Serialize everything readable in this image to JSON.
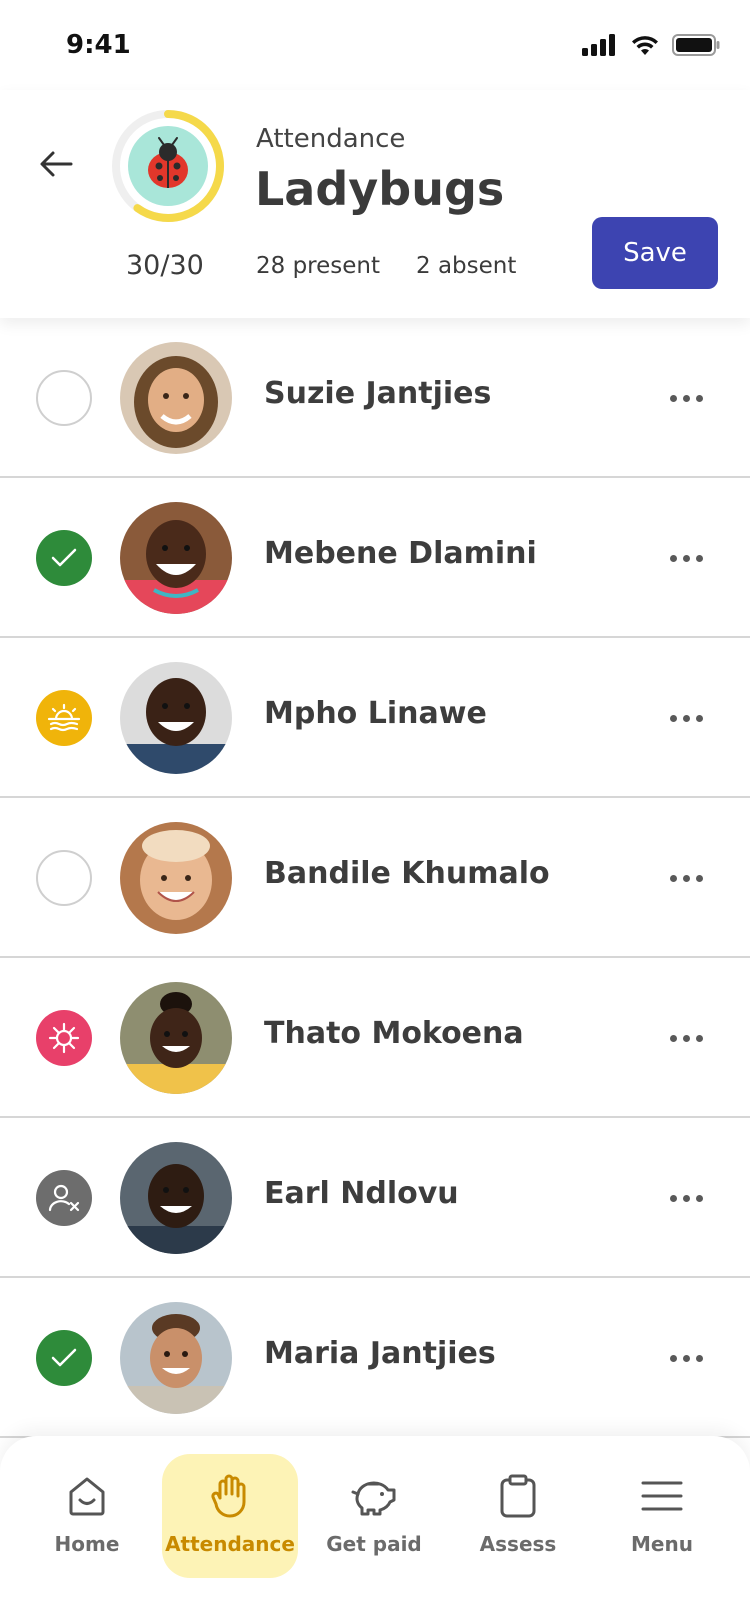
{
  "status_bar": {
    "time": "9:41"
  },
  "header": {
    "subtitle": "Attendance",
    "title": "Ladybugs",
    "count_total": "30/30",
    "count_present": "28 present",
    "count_absent": "2 absent",
    "save_label": "Save",
    "progress": 0.6
  },
  "children": [
    {
      "name": "Suzie Jantjies",
      "status": "unmarked"
    },
    {
      "name": "Mebene Dlamini",
      "status": "present"
    },
    {
      "name": "Mpho Linawe",
      "status": "late"
    },
    {
      "name": "Bandile Khumalo",
      "status": "unmarked"
    },
    {
      "name": "Thato Mokoena",
      "status": "sick"
    },
    {
      "name": "Earl Ndlovu",
      "status": "absent"
    },
    {
      "name": "Maria Jantjies",
      "status": "present"
    }
  ],
  "nav": {
    "items": [
      {
        "label": "Home",
        "icon": "home-icon"
      },
      {
        "label": "Attendance",
        "icon": "hand-icon",
        "active": true
      },
      {
        "label": "Get paid",
        "icon": "piggy-bank-icon"
      },
      {
        "label": "Assess",
        "icon": "clipboard-icon"
      },
      {
        "label": "Menu",
        "icon": "menu-icon"
      }
    ]
  },
  "colors": {
    "accent": "#3d44b1",
    "present": "#2e8b3a",
    "late": "#f0b40a",
    "sick": "#e8406a",
    "absent": "#6d6d6d",
    "nav_active_bg": "#fdf3b6",
    "progress_ring": "#f5d94a"
  }
}
